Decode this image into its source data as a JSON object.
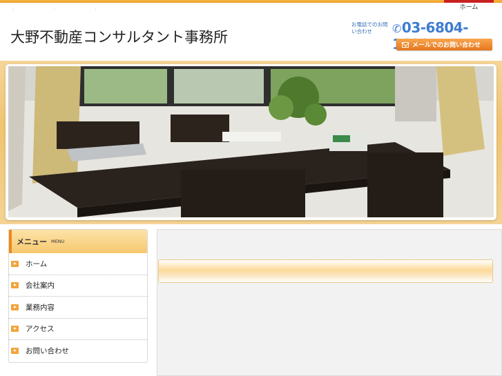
{
  "header": {
    "site_title": "大野不動産コンサルタント事務所",
    "tel_label": "お電話でのお問い合わせ",
    "tel_number": "03-6804-1600",
    "mail_button": "メールでのお問い合わせ",
    "top_nav": "ホーム"
  },
  "menu": {
    "title": "メニュー",
    "title_en": "MENU",
    "items": [
      {
        "label": "ホーム"
      },
      {
        "label": "会社案内"
      },
      {
        "label": "業務内容"
      },
      {
        "label": "アクセス"
      },
      {
        "label": "お問い合わせ"
      }
    ]
  },
  "colors": {
    "accent_orange": "#ee8a16",
    "tel_blue": "#3d7cd0",
    "nav_red": "#c8201f"
  }
}
